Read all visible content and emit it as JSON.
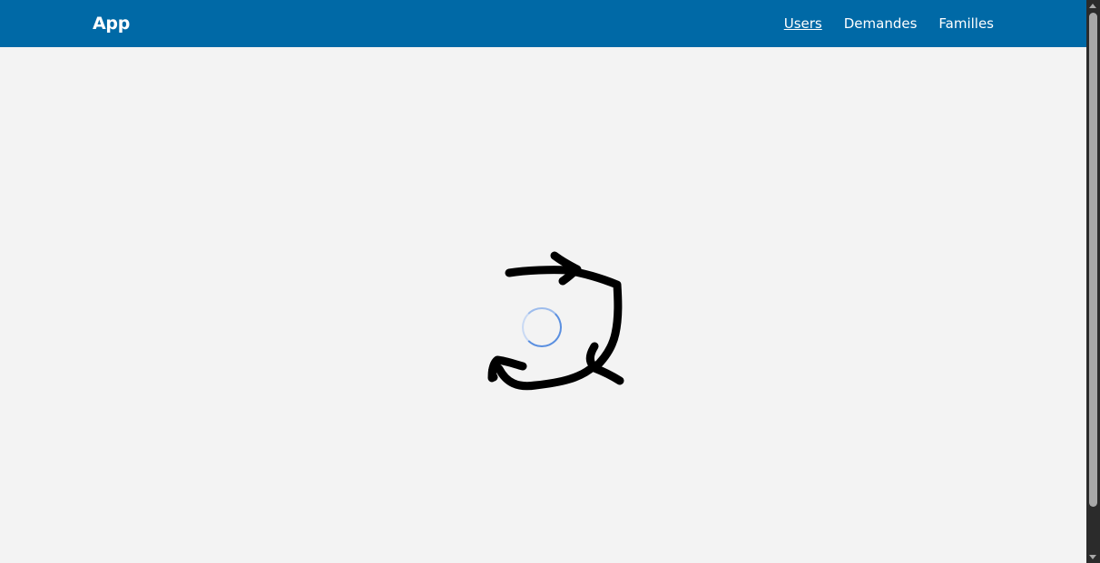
{
  "header": {
    "brand": "App",
    "nav": [
      {
        "label": "Users",
        "active": true
      },
      {
        "label": "Demandes",
        "active": false
      },
      {
        "label": "Familles",
        "active": false
      }
    ]
  },
  "main": {
    "loading_indicator": "loading-spinner-icon",
    "overlay_drawing": "refresh-arrows-icon"
  },
  "colors": {
    "header_bg": "#0069a6",
    "page_bg": "#f3f3f3",
    "spinner": "#5a8fe0",
    "drawing": "#000000"
  }
}
